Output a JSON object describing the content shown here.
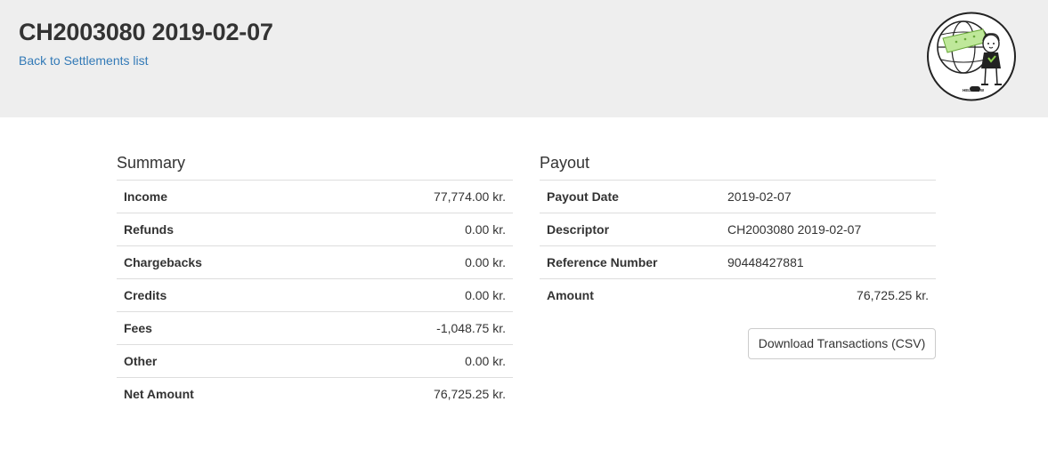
{
  "header": {
    "title": "CH2003080 2019-02-07",
    "back_link": "Back to Settlements list",
    "logo_text": "HELP NOW"
  },
  "summary": {
    "title": "Summary",
    "rows": [
      {
        "label": "Income",
        "value": "77,774.00 kr."
      },
      {
        "label": "Refunds",
        "value": "0.00 kr."
      },
      {
        "label": "Chargebacks",
        "value": "0.00 kr."
      },
      {
        "label": "Credits",
        "value": "0.00 kr."
      },
      {
        "label": "Fees",
        "value": "-1,048.75 kr."
      },
      {
        "label": "Other",
        "value": "0.00 kr."
      },
      {
        "label": "Net Amount",
        "value": "76,725.25 kr."
      }
    ]
  },
  "payout": {
    "title": "Payout",
    "rows": [
      {
        "label": "Payout Date",
        "value": "2019-02-07"
      },
      {
        "label": "Descriptor",
        "value": "CH2003080 2019-02-07"
      },
      {
        "label": "Reference Number",
        "value": "90448427881"
      }
    ],
    "amount_label": "Amount",
    "amount_value": "76,725.25 kr.",
    "download_label": "Download Transactions (CSV)"
  },
  "colors": {
    "header_bg": "#eeeeee",
    "link": "#337ab7",
    "text": "#333333",
    "border": "#dddddd",
    "logo_accent": "#8fd14f"
  },
  "icons": {
    "logo": "globe-mascot-logo-icon"
  }
}
